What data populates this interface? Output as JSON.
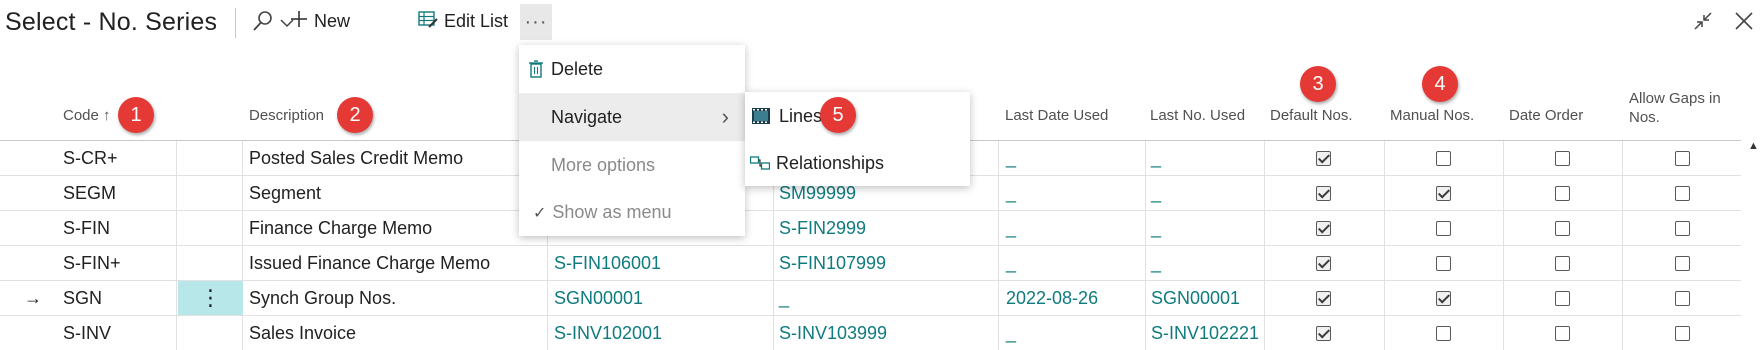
{
  "header": {
    "title": "Select - No. Series",
    "new_label": "New",
    "edit_list_label": "Edit List",
    "more_label": "···",
    "search_icon": "search-icon",
    "chevron_icon": "chevron-down-icon"
  },
  "columns": {
    "code": "Code",
    "code_sort": "↑",
    "description": "Description",
    "last_date_used": "Last Date Used",
    "last_no_used": "Last No. Used",
    "default_nos": "Default Nos.",
    "manual_nos": "Manual Nos.",
    "date_order": "Date Order",
    "allow_gaps_1": "Allow Gaps in",
    "allow_gaps_2": "Nos."
  },
  "rows": [
    {
      "code": "S-CR+",
      "description": "Posted Sales Credit Memo",
      "starting_no": "",
      "ending_no": "",
      "last_date": "_",
      "last_no": "_",
      "default": true,
      "manual": false,
      "date_order": false,
      "gaps": false,
      "current": false
    },
    {
      "code": "SEGM",
      "description": "Segment",
      "starting_no": "",
      "ending_no": "SM99999",
      "last_date": "_",
      "last_no": "_",
      "default": true,
      "manual": true,
      "date_order": false,
      "gaps": false,
      "current": false
    },
    {
      "code": "S-FIN",
      "description": "Finance Charge Memo",
      "starting_no": "",
      "ending_no": "S-FIN2999",
      "last_date": "_",
      "last_no": "_",
      "default": true,
      "manual": false,
      "date_order": false,
      "gaps": false,
      "current": false
    },
    {
      "code": "S-FIN+",
      "description": "Issued Finance Charge Memo",
      "starting_no": "S-FIN106001",
      "ending_no": "S-FIN107999",
      "last_date": "_",
      "last_no": "_",
      "default": true,
      "manual": false,
      "date_order": false,
      "gaps": false,
      "current": false
    },
    {
      "code": "SGN",
      "description": "Synch Group Nos.",
      "starting_no": "SGN00001",
      "ending_no": "_",
      "last_date": "2022-08-26",
      "last_no": "SGN00001",
      "default": true,
      "manual": true,
      "date_order": false,
      "gaps": false,
      "current": true
    },
    {
      "code": "S-INV",
      "description": "Sales Invoice",
      "starting_no": "S-INV102001",
      "ending_no": "S-INV103999",
      "last_date": "_",
      "last_no": "S-INV102221",
      "default": true,
      "manual": false,
      "date_order": false,
      "gaps": false,
      "current": false
    }
  ],
  "row_pointer": "→",
  "row_menu": "⋮",
  "more_menu": {
    "delete": "Delete",
    "navigate": "Navigate",
    "more_options": "More options",
    "show_as_menu": "Show as menu",
    "check": "✓",
    "chevron": "›"
  },
  "navigate_menu": {
    "lines": "Lines",
    "relationships": "Relationships"
  },
  "badges": [
    "1",
    "2",
    "3",
    "4",
    "5"
  ],
  "colors": {
    "accent_link": "#0f7b7e",
    "badge": "#e53935",
    "row_menu_bg": "#b8e7ea"
  }
}
